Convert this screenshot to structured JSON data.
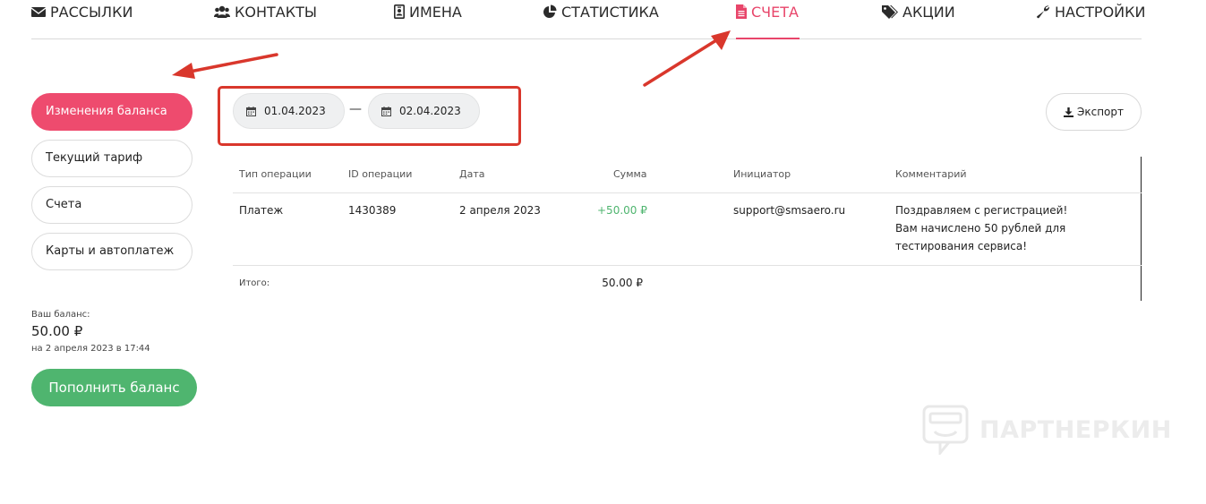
{
  "nav": {
    "items": [
      {
        "label": "РАССЫЛКИ",
        "icon": "envelope-icon"
      },
      {
        "label": "КОНТАКТЫ",
        "icon": "users-icon"
      },
      {
        "label": "ИМЕНА",
        "icon": "id-badge-icon"
      },
      {
        "label": "СТАТИСТИКА",
        "icon": "pie-chart-icon"
      },
      {
        "label": "СЧЕТА",
        "icon": "file-icon",
        "active": true
      },
      {
        "label": "АКЦИИ",
        "icon": "tags-icon"
      },
      {
        "label": "НАСТРОЙКИ",
        "icon": "wrench-icon"
      }
    ]
  },
  "sidebar": {
    "items": [
      {
        "label": "Изменения баланса",
        "active": true
      },
      {
        "label": "Текущий тариф"
      },
      {
        "label": "Счета"
      },
      {
        "label": "Карты и автоплатеж"
      }
    ]
  },
  "balance": {
    "label": "Ваш баланс:",
    "value": "50.00 ₽",
    "date": "на 2 апреля 2023 в 17:44",
    "topup_label": "Пополнить баланс"
  },
  "range": {
    "from": "01.04.2023",
    "dash": "—",
    "to": "02.04.2023"
  },
  "export": {
    "label": "Экспорт"
  },
  "table": {
    "headers": [
      "Тип операции",
      "ID операции",
      "Дата",
      "Сумма",
      "Инициатор",
      "Комментарий"
    ],
    "rows": [
      {
        "type": "Платеж",
        "id": "1430389",
        "date": "2 апреля 2023",
        "amount": "+50.00 ₽",
        "initiator": "support@smsaero.ru",
        "comment": "Поздравляем с регистрацией! Вам начислено 50 рублей для тестирования сервиса!"
      }
    ],
    "total_label": "Итого:",
    "total_value": "50.00 ₽"
  },
  "watermark": {
    "text": "ПАРТНЕРКИН"
  },
  "colors": {
    "accent": "#ee4b6e",
    "active_nav": "#e8456a",
    "success": "#4fb56f",
    "annotation": "#d9372c"
  }
}
